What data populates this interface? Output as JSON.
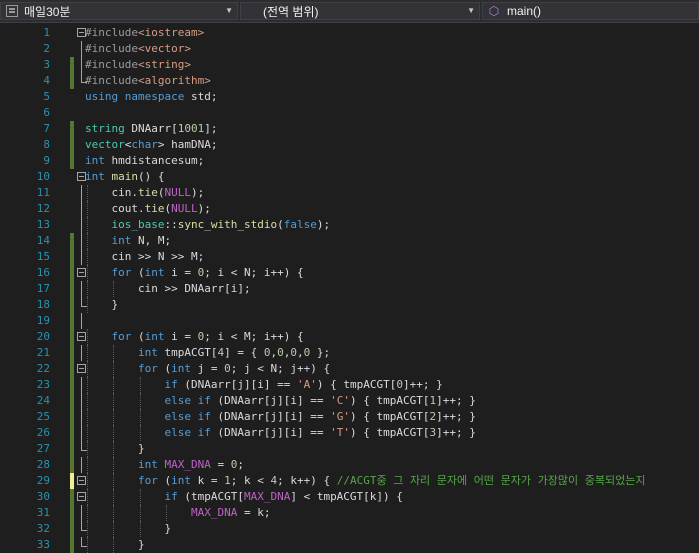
{
  "navbar": {
    "project": "매일30분",
    "scope": "(전역 범위)",
    "member": "main()"
  },
  "colors": {
    "background": "#1e1e1e",
    "line_number": "#2b91af",
    "keyword": "#569cd6",
    "type": "#4ec9b0",
    "string": "#d69d85",
    "comment": "#57a64a",
    "saved_change": "#577430",
    "unsaved_change": "#efef91"
  },
  "lines": [
    {
      "n": "1",
      "chg": "",
      "fold": "box",
      "tokens": [
        [
          "pp",
          "#include"
        ],
        [
          "str",
          "<iostream>"
        ]
      ]
    },
    {
      "n": "2",
      "chg": "",
      "fold": "line",
      "tokens": [
        [
          "pp",
          "#include"
        ],
        [
          "str",
          "<vector>"
        ]
      ]
    },
    {
      "n": "3",
      "chg": "saved",
      "fold": "line",
      "tokens": [
        [
          "pp",
          "#include"
        ],
        [
          "str",
          "<string>"
        ]
      ]
    },
    {
      "n": "4",
      "chg": "saved",
      "fold": "end",
      "tokens": [
        [
          "pp",
          "#include"
        ],
        [
          "str",
          "<algorithm>"
        ]
      ]
    },
    {
      "n": "5",
      "chg": "",
      "fold": "",
      "tokens": [
        [
          "kw",
          "using"
        ],
        [
          "plain",
          " "
        ],
        [
          "kw",
          "namespace"
        ],
        [
          "plain",
          " std;"
        ]
      ]
    },
    {
      "n": "6",
      "chg": "",
      "fold": "",
      "tokens": []
    },
    {
      "n": "7",
      "chg": "saved",
      "fold": "",
      "tokens": [
        [
          "type",
          "string"
        ],
        [
          "plain",
          " "
        ],
        [
          "var",
          "DNAarr"
        ],
        [
          "plain",
          "["
        ],
        [
          "num",
          "1001"
        ],
        [
          "plain",
          "];"
        ]
      ]
    },
    {
      "n": "8",
      "chg": "saved",
      "fold": "",
      "tokens": [
        [
          "type",
          "vector"
        ],
        [
          "plain",
          "<"
        ],
        [
          "kw",
          "char"
        ],
        [
          "plain",
          "> "
        ],
        [
          "var",
          "hamDNA"
        ],
        [
          "plain",
          ";"
        ]
      ]
    },
    {
      "n": "9",
      "chg": "saved",
      "fold": "",
      "tokens": [
        [
          "kw",
          "int"
        ],
        [
          "plain",
          " "
        ],
        [
          "var",
          "hmdistancesum"
        ],
        [
          "plain",
          ";"
        ]
      ]
    },
    {
      "n": "10",
      "chg": "",
      "fold": "box",
      "tokens": [
        [
          "kw",
          "int"
        ],
        [
          "plain",
          " "
        ],
        [
          "func",
          "main"
        ],
        [
          "plain",
          "() {"
        ]
      ]
    },
    {
      "n": "11",
      "chg": "",
      "fold": "line",
      "tokens": [
        [
          "plain",
          "    "
        ],
        [
          "var",
          "cin"
        ],
        [
          "plain",
          "."
        ],
        [
          "func",
          "tie"
        ],
        [
          "plain",
          "("
        ],
        [
          "macro",
          "NULL"
        ],
        [
          "plain",
          ");"
        ]
      ]
    },
    {
      "n": "12",
      "chg": "",
      "fold": "line",
      "tokens": [
        [
          "plain",
          "    "
        ],
        [
          "var",
          "cout"
        ],
        [
          "plain",
          "."
        ],
        [
          "func",
          "tie"
        ],
        [
          "plain",
          "("
        ],
        [
          "macro",
          "NULL"
        ],
        [
          "plain",
          ");"
        ]
      ]
    },
    {
      "n": "13",
      "chg": "",
      "fold": "line",
      "tokens": [
        [
          "plain",
          "    "
        ],
        [
          "type",
          "ios_base"
        ],
        [
          "plain",
          "::"
        ],
        [
          "func",
          "sync_with_stdio"
        ],
        [
          "plain",
          "("
        ],
        [
          "kw",
          "false"
        ],
        [
          "plain",
          ");"
        ]
      ]
    },
    {
      "n": "14",
      "chg": "saved",
      "fold": "line",
      "tokens": [
        [
          "plain",
          "    "
        ],
        [
          "kw",
          "int"
        ],
        [
          "plain",
          " N, M;"
        ]
      ]
    },
    {
      "n": "15",
      "chg": "saved",
      "fold": "line",
      "tokens": [
        [
          "plain",
          "    "
        ],
        [
          "var",
          "cin"
        ],
        [
          "plain",
          " >> N >> M;"
        ]
      ]
    },
    {
      "n": "16",
      "chg": "saved",
      "fold": "box",
      "tokens": [
        [
          "plain",
          "    "
        ],
        [
          "kw",
          "for"
        ],
        [
          "plain",
          " ("
        ],
        [
          "kw",
          "int"
        ],
        [
          "plain",
          " i = "
        ],
        [
          "num",
          "0"
        ],
        [
          "plain",
          "; i < N; i++) {"
        ]
      ]
    },
    {
      "n": "17",
      "chg": "saved",
      "fold": "line",
      "tokens": [
        [
          "plain",
          "        "
        ],
        [
          "var",
          "cin"
        ],
        [
          "plain",
          " >> "
        ],
        [
          "var",
          "DNAarr"
        ],
        [
          "plain",
          "[i];"
        ]
      ]
    },
    {
      "n": "18",
      "chg": "saved",
      "fold": "end",
      "tokens": [
        [
          "plain",
          "    }"
        ]
      ]
    },
    {
      "n": "19",
      "chg": "saved",
      "fold": "line",
      "tokens": []
    },
    {
      "n": "20",
      "chg": "saved",
      "fold": "box",
      "tokens": [
        [
          "plain",
          "    "
        ],
        [
          "kw",
          "for"
        ],
        [
          "plain",
          " ("
        ],
        [
          "kw",
          "int"
        ],
        [
          "plain",
          " i = "
        ],
        [
          "num",
          "0"
        ],
        [
          "plain",
          "; i < M; i++) {"
        ]
      ]
    },
    {
      "n": "21",
      "chg": "saved",
      "fold": "line",
      "tokens": [
        [
          "plain",
          "        "
        ],
        [
          "kw",
          "int"
        ],
        [
          "plain",
          " tmpACGT["
        ],
        [
          "num",
          "4"
        ],
        [
          "plain",
          "] = { "
        ],
        [
          "num",
          "0"
        ],
        [
          "plain",
          ","
        ],
        [
          "num",
          "0"
        ],
        [
          "plain",
          ","
        ],
        [
          "num",
          "0"
        ],
        [
          "plain",
          ","
        ],
        [
          "num",
          "0"
        ],
        [
          "plain",
          " };"
        ]
      ]
    },
    {
      "n": "22",
      "chg": "saved",
      "fold": "box",
      "tokens": [
        [
          "plain",
          "        "
        ],
        [
          "kw",
          "for"
        ],
        [
          "plain",
          " ("
        ],
        [
          "kw",
          "int"
        ],
        [
          "plain",
          " j = "
        ],
        [
          "num",
          "0"
        ],
        [
          "plain",
          "; j < N; j++) {"
        ]
      ]
    },
    {
      "n": "23",
      "chg": "saved",
      "fold": "line",
      "tokens": [
        [
          "plain",
          "            "
        ],
        [
          "kw",
          "if"
        ],
        [
          "plain",
          " ("
        ],
        [
          "var",
          "DNAarr"
        ],
        [
          "plain",
          "[j][i] == "
        ],
        [
          "str",
          "'A'"
        ],
        [
          "plain",
          ") { tmpACGT["
        ],
        [
          "num",
          "0"
        ],
        [
          "plain",
          "]++; }"
        ]
      ]
    },
    {
      "n": "24",
      "chg": "saved",
      "fold": "line",
      "tokens": [
        [
          "plain",
          "            "
        ],
        [
          "kw",
          "else"
        ],
        [
          "plain",
          " "
        ],
        [
          "kw",
          "if"
        ],
        [
          "plain",
          " ("
        ],
        [
          "var",
          "DNAarr"
        ],
        [
          "plain",
          "[j][i] == "
        ],
        [
          "str",
          "'C'"
        ],
        [
          "plain",
          ") { tmpACGT["
        ],
        [
          "num",
          "1"
        ],
        [
          "plain",
          "]++; }"
        ]
      ]
    },
    {
      "n": "25",
      "chg": "saved",
      "fold": "line",
      "tokens": [
        [
          "plain",
          "            "
        ],
        [
          "kw",
          "else"
        ],
        [
          "plain",
          " "
        ],
        [
          "kw",
          "if"
        ],
        [
          "plain",
          " ("
        ],
        [
          "var",
          "DNAarr"
        ],
        [
          "plain",
          "[j][i] == "
        ],
        [
          "str",
          "'G'"
        ],
        [
          "plain",
          ") { tmpACGT["
        ],
        [
          "num",
          "2"
        ],
        [
          "plain",
          "]++; }"
        ]
      ]
    },
    {
      "n": "26",
      "chg": "saved",
      "fold": "line",
      "tokens": [
        [
          "plain",
          "            "
        ],
        [
          "kw",
          "else"
        ],
        [
          "plain",
          " "
        ],
        [
          "kw",
          "if"
        ],
        [
          "plain",
          " ("
        ],
        [
          "var",
          "DNAarr"
        ],
        [
          "plain",
          "[j][i] == "
        ],
        [
          "str",
          "'T'"
        ],
        [
          "plain",
          ") { tmpACGT["
        ],
        [
          "num",
          "3"
        ],
        [
          "plain",
          "]++; }"
        ]
      ]
    },
    {
      "n": "27",
      "chg": "saved",
      "fold": "end",
      "tokens": [
        [
          "plain",
          "        }"
        ]
      ]
    },
    {
      "n": "28",
      "chg": "saved",
      "fold": "line",
      "tokens": [
        [
          "plain",
          "        "
        ],
        [
          "kw",
          "int"
        ],
        [
          "plain",
          " "
        ],
        [
          "macro",
          "MAX_DNA"
        ],
        [
          "plain",
          " = "
        ],
        [
          "num",
          "0"
        ],
        [
          "plain",
          ";"
        ]
      ]
    },
    {
      "n": "29",
      "chg": "unsaved",
      "fold": "box",
      "tokens": [
        [
          "plain",
          "        "
        ],
        [
          "kw",
          "for"
        ],
        [
          "plain",
          " ("
        ],
        [
          "kw",
          "int"
        ],
        [
          "plain",
          " k = "
        ],
        [
          "num",
          "1"
        ],
        [
          "plain",
          "; k < "
        ],
        [
          "num",
          "4"
        ],
        [
          "plain",
          "; k++) { "
        ],
        [
          "comment",
          "//ACGT중 그 자리 문자에 어떤 문자가 가장많이 중복되었는지"
        ]
      ]
    },
    {
      "n": "30",
      "chg": "saved",
      "fold": "box",
      "tokens": [
        [
          "plain",
          "            "
        ],
        [
          "kw",
          "if"
        ],
        [
          "plain",
          " (tmpACGT["
        ],
        [
          "macro",
          "MAX_DNA"
        ],
        [
          "plain",
          "] < tmpACGT[k]) {"
        ]
      ]
    },
    {
      "n": "31",
      "chg": "saved",
      "fold": "line",
      "tokens": [
        [
          "plain",
          "                "
        ],
        [
          "macro",
          "MAX_DNA"
        ],
        [
          "plain",
          " = k;"
        ]
      ]
    },
    {
      "n": "32",
      "chg": "saved",
      "fold": "end",
      "tokens": [
        [
          "plain",
          "            }"
        ]
      ]
    },
    {
      "n": "33",
      "chg": "saved",
      "fold": "end",
      "tokens": [
        [
          "plain",
          "        }"
        ]
      ]
    }
  ]
}
